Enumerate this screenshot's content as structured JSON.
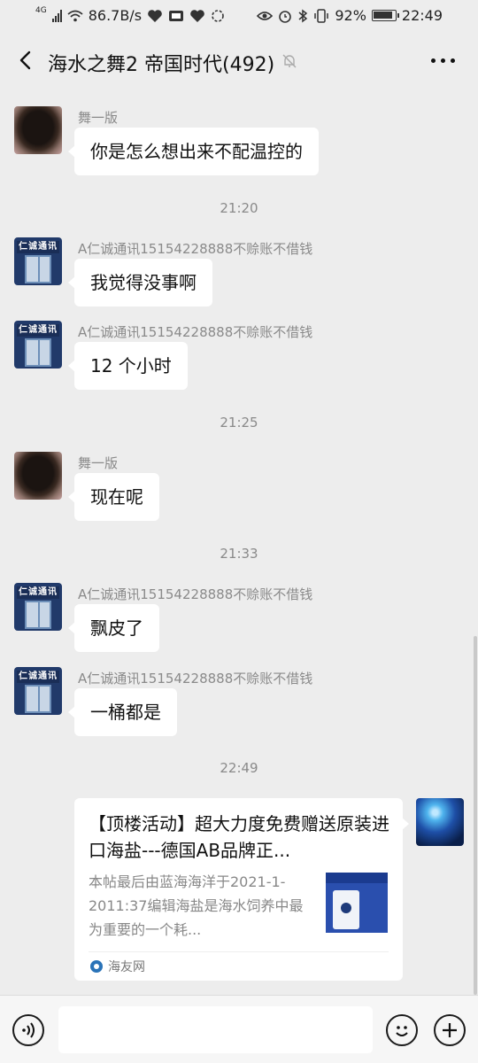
{
  "status_bar": {
    "network": "4G",
    "speed": "86.7B/s",
    "battery": "92%",
    "time": "22:49"
  },
  "header": {
    "title": "海水之舞2 帝国时代(492)",
    "icons": [
      "back-icon",
      "mute-icon",
      "more-icon"
    ]
  },
  "messages": [
    {
      "sender": "舞一版",
      "text": "你是怎么想出来不配温控的"
    },
    {
      "time": "21:20"
    },
    {
      "sender": "A仁诚通讯15154228888不赊账不借钱",
      "avatar_sign": "仁诚通讯",
      "text": "我觉得没事啊"
    },
    {
      "sender": "A仁诚通讯15154228888不赊账不借钱",
      "avatar_sign": "仁诚通讯",
      "text": "12 个小时"
    },
    {
      "time": "21:25"
    },
    {
      "sender": "舞一版",
      "text": "现在呢"
    },
    {
      "time": "21:33"
    },
    {
      "sender": "A仁诚通讯15154228888不赊账不借钱",
      "avatar_sign": "仁诚通讯",
      "text": "飘皮了"
    },
    {
      "sender": "A仁诚通讯15154228888不赊账不借钱",
      "avatar_sign": "仁诚通讯",
      "text": "一桶都是"
    },
    {
      "time": "22:49"
    }
  ],
  "link_card": {
    "title": "【顶楼活动】超大力度免费赠送原装进口海盐---德国AB品牌正...",
    "description": "本帖最后由蓝海海洋于2021-1-2011:37编辑海盐是海水饲养中最为重要的一个耗...",
    "source": "海友网"
  },
  "input_bar": {
    "icons": [
      "voice-icon",
      "emoji-icon",
      "plus-icon"
    ],
    "value": ""
  }
}
